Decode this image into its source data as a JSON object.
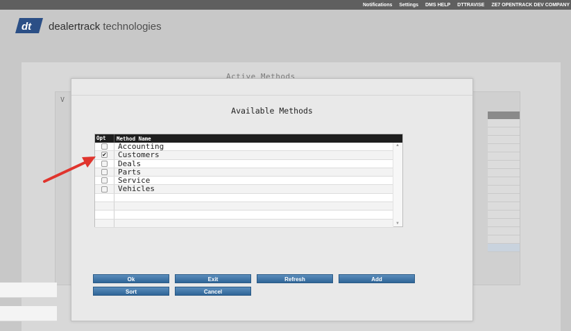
{
  "topnav": [
    "Notifications",
    "Settings",
    "DMS HELP",
    "DTTRAVISE",
    "ZE7 OPENTRACK DEV COMPANY"
  ],
  "brand": {
    "bold": "dealertrack",
    "rest": " technologies"
  },
  "background": {
    "title": "Active Methods",
    "inner_label": "V"
  },
  "modal": {
    "title": "Available Methods",
    "columns": {
      "opt": "Opt",
      "name": "Method Name"
    },
    "rows": [
      {
        "name": "Accounting",
        "checked": false
      },
      {
        "name": "Customers",
        "checked": true
      },
      {
        "name": "Deals",
        "checked": false
      },
      {
        "name": "Parts",
        "checked": false
      },
      {
        "name": "Service",
        "checked": false
      },
      {
        "name": "Vehicles",
        "checked": false
      },
      {
        "name": "",
        "checked": null
      },
      {
        "name": "",
        "checked": null
      },
      {
        "name": "",
        "checked": null
      },
      {
        "name": "",
        "checked": null
      }
    ],
    "buttons": {
      "ok": "Ok",
      "exit": "Exit",
      "refresh": "Refresh",
      "add": "Add",
      "sort": "Sort",
      "cancel": "Cancel"
    }
  },
  "colors": {
    "accent": "#3f76a8",
    "arrow": "#e0342d",
    "header_bg": "#1e1e1e"
  },
  "icons": {
    "checkbox_checked": "check-icon",
    "annotation": "red-arrow-icon"
  }
}
